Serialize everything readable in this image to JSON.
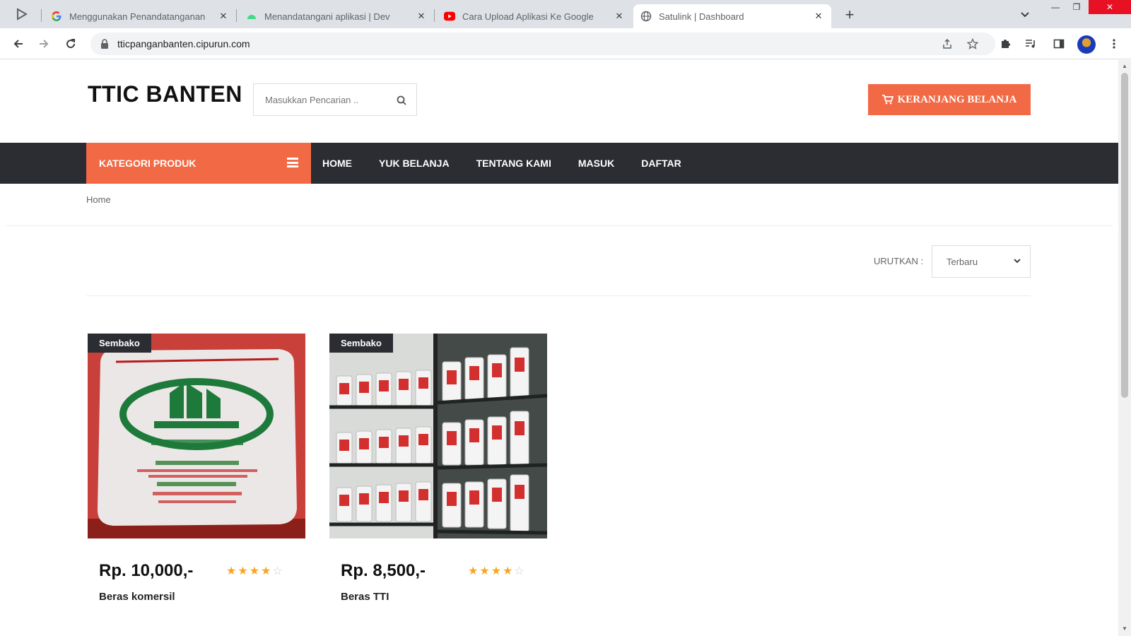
{
  "browser": {
    "tabs": [
      {
        "title": "Menggunakan Penandatanganan",
        "icon": "google-icon",
        "active": false
      },
      {
        "title": "Menandatangani aplikasi | Dev",
        "icon": "android-icon",
        "active": false
      },
      {
        "title": "Cara Upload Aplikasi Ke Google",
        "icon": "youtube-icon",
        "active": false
      },
      {
        "title": "Satulink | Dashboard",
        "icon": "globe-icon",
        "active": true
      }
    ],
    "new_tab_label": "+",
    "url": "tticpanganbanten.cipurun.com"
  },
  "site": {
    "brand": "TTIC BANTEN",
    "search_placeholder": "Masukkan Pencarian ..",
    "cart_label": "KERANJANG BELANJA",
    "category_label": "KATEGORI PRODUK",
    "menu": [
      "HOME",
      "YUK BELANJA",
      "TENTANG KAMI",
      "MASUK",
      "DAFTAR"
    ],
    "breadcrumb": "Home",
    "sort_label": "URUTKAN :",
    "sort_value": "Terbaru"
  },
  "products": [
    {
      "badge": "Sembako",
      "price": "Rp. 10,000,-",
      "rating": 4,
      "rating_max": 5,
      "name": "Beras komersil"
    },
    {
      "badge": "Sembako",
      "price": "Rp. 8,500,-",
      "rating": 4,
      "rating_max": 5,
      "name": "Beras TTI"
    }
  ],
  "colors": {
    "accent": "#f26a45",
    "nav_dark": "#2b2d33",
    "star": "#f5a623"
  }
}
